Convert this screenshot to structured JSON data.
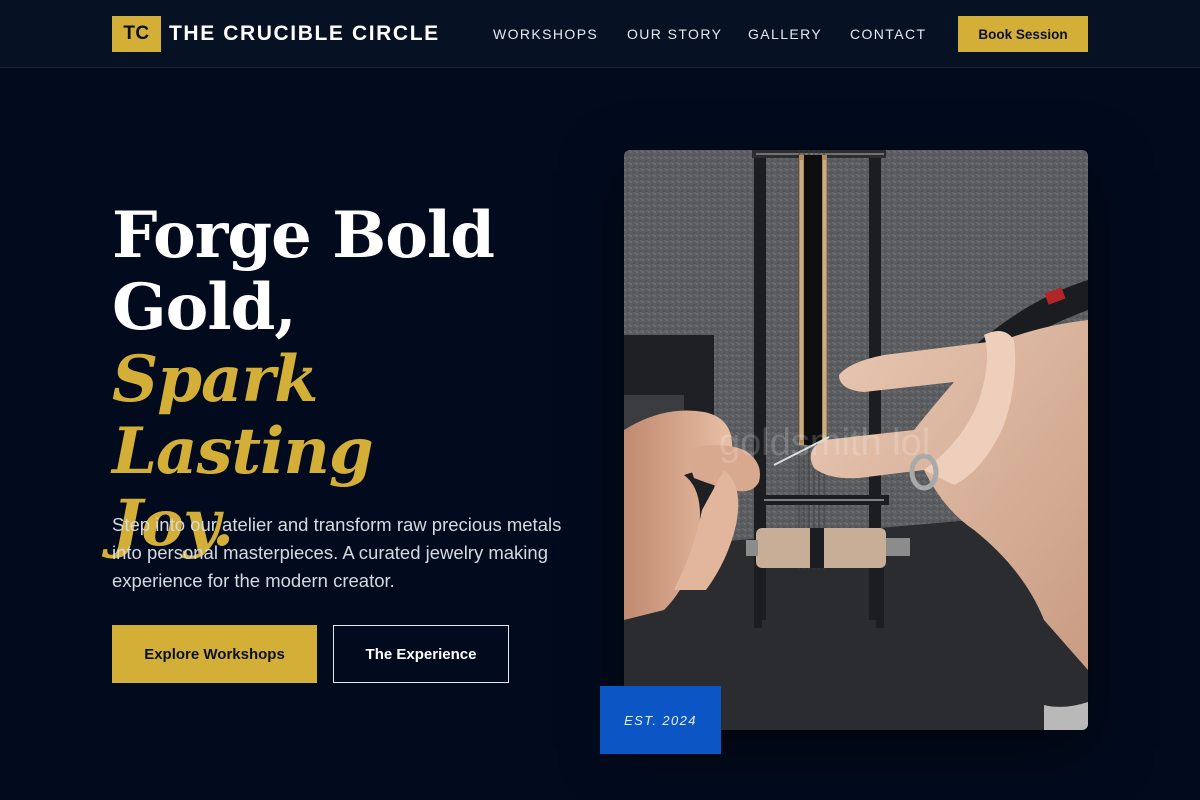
{
  "header": {
    "logo_initials": "TC",
    "brand_name": "THE CRUCIBLE CIRCLE",
    "nav": [
      "WORKSHOPS",
      "OUR STORY",
      "GALLERY",
      "CONTACT"
    ],
    "cta_label": "Book Session"
  },
  "hero": {
    "title_line1": "Forge Bold",
    "title_line2": "Gold,",
    "title_accent_line1": "Spark Lasting",
    "title_accent_line2": "Joy.",
    "description": "Step into our atelier and transform raw precious metals into personal masterpieces. A curated jewelry making experience for the modern creator.",
    "primary_button": "Explore Workshops",
    "secondary_button": "The Experience",
    "image_watermark": "goldsmith lol",
    "badge": "EST. 2024"
  },
  "colors": {
    "background": "#020b1e",
    "header_bg": "#071124",
    "accent_gold": "#d4af37",
    "badge_blue": "#0b56c4"
  },
  "icons": [
    "beading-loom-photo"
  ]
}
